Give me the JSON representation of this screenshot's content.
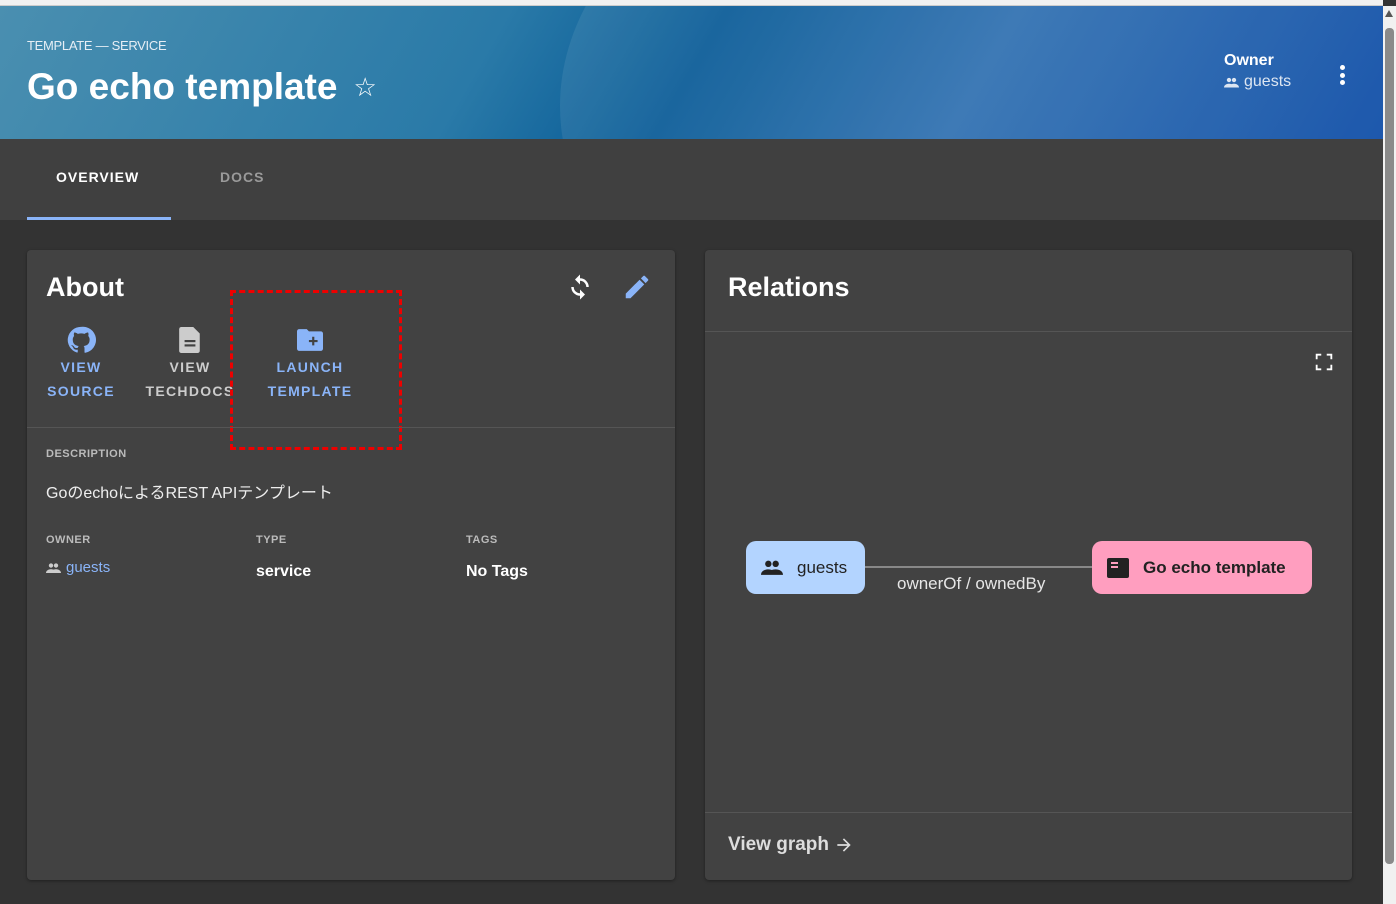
{
  "header": {
    "kind": "TEMPLATE — SERVICE",
    "title": "Go echo template",
    "owner_label": "Owner",
    "owner_value": "guests"
  },
  "tabs": [
    {
      "label": "OVERVIEW"
    },
    {
      "label": "DOCS"
    }
  ],
  "about": {
    "title": "About",
    "links": [
      {
        "line1": "VIEW",
        "line2": "SOURCE"
      },
      {
        "line1": "VIEW",
        "line2": "TECHDOCS"
      },
      {
        "line1": "LAUNCH",
        "line2": "TEMPLATE"
      }
    ],
    "description_label": "DESCRIPTION",
    "description": "GoのechoによるREST APIテンプレート",
    "owner_label": "OWNER",
    "owner": "guests",
    "type_label": "TYPE",
    "type": "service",
    "tags_label": "TAGS",
    "tags": "No Tags"
  },
  "relations": {
    "title": "Relations",
    "source_node": "guests",
    "edge_label": "ownerOf / ownedBy",
    "target_node": "Go echo template",
    "view_graph": "View graph"
  },
  "colors": {
    "accent": "#8ab4f8",
    "node_group": "#b3d4ff",
    "node_component": "#ff9ebf",
    "highlight": "#e00000"
  }
}
